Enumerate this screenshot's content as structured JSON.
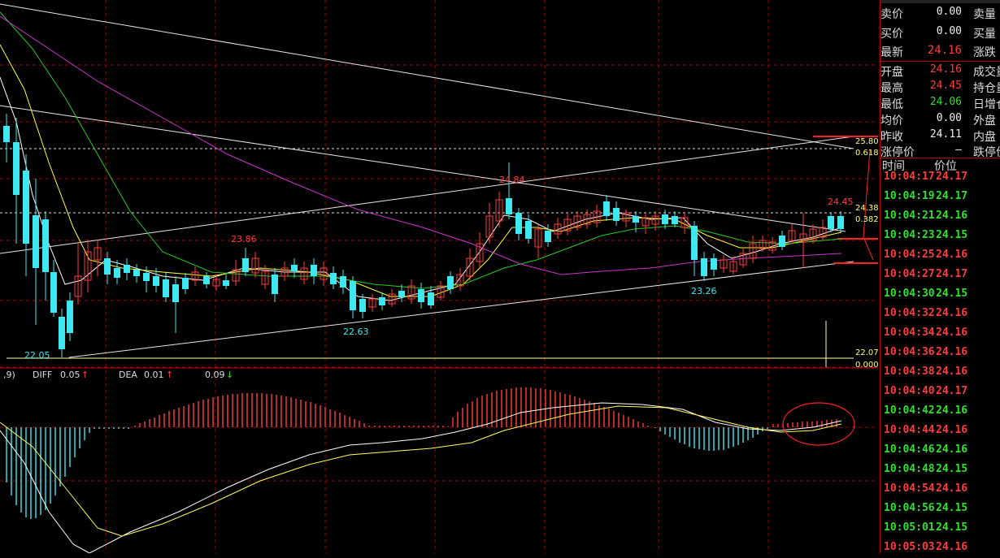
{
  "chart_labels": {
    "high_price": "24.84",
    "mid_peak": "23.86",
    "low_left": "22.05",
    "low_mid": "22.63",
    "low_right": "23.26",
    "recent_high": "24.45",
    "level_upper": "25.80",
    "fib_upper": "0.618",
    "level_mid": "24.38",
    "fib_mid": "0.382",
    "level_lower": "22.07",
    "fib_lower": "0.000"
  },
  "macd": {
    "params": ",9)",
    "diff_label": "DIFF",
    "diff_value": "0.05",
    "diff_arrow": "↑",
    "dea_label": "DEA",
    "dea_value": "0.01",
    "dea_arrow": "↑",
    "macd_value": "0.09",
    "macd_arrow": "↓"
  },
  "quote": {
    "sell_label": "卖价",
    "sell_value": "0.00",
    "sell_vol_label": "卖量",
    "buy_label": "买价",
    "buy_value": "0.00",
    "buy_vol_label": "买量",
    "last_label": "最新",
    "last_value": "24.16",
    "change_label": "涨跌",
    "open_label": "开盘",
    "open_value": "24.16",
    "volume_label": "成交量",
    "high_label": "最高",
    "high_value": "24.45",
    "position_label": "持仓量",
    "low_label": "最低",
    "low_value": "24.06",
    "daily_inc_label": "日增仓",
    "avg_label": "均价",
    "avg_value": "0.00",
    "outer_label": "外盘",
    "prev_label": "昨收",
    "prev_value": "24.11",
    "inner_label": "内盘",
    "limit_up_label": "涨停价",
    "limit_up_value": "—",
    "limit_down_label": "跌停价"
  },
  "ticks_header": {
    "time": "时间",
    "price": "价位"
  },
  "ticks": [
    {
      "time": "10:04:17",
      "price": "24.17",
      "tc": "r",
      "pc": "r"
    },
    {
      "time": "10:04:19",
      "price": "24.17",
      "tc": "g",
      "pc": "g"
    },
    {
      "time": "10:04:21",
      "price": "24.16",
      "tc": "g",
      "pc": "g"
    },
    {
      "time": "10:04:23",
      "price": "24.15",
      "tc": "g",
      "pc": "g"
    },
    {
      "time": "10:04:25",
      "price": "24.16",
      "tc": "r",
      "pc": "r"
    },
    {
      "time": "10:04:27",
      "price": "24.17",
      "tc": "r",
      "pc": "r"
    },
    {
      "time": "10:04:30",
      "price": "24.15",
      "tc": "g",
      "pc": "g"
    },
    {
      "time": "10:04:32",
      "price": "24.16",
      "tc": "r",
      "pc": "r"
    },
    {
      "time": "10:04:34",
      "price": "24.16",
      "tc": "r",
      "pc": "r"
    },
    {
      "time": "10:04:36",
      "price": "24.16",
      "tc": "r",
      "pc": "r"
    },
    {
      "time": "10:04:38",
      "price": "24.16",
      "tc": "r",
      "pc": "r"
    },
    {
      "time": "10:04:40",
      "price": "24.17",
      "tc": "r",
      "pc": "r"
    },
    {
      "time": "10:04:42",
      "price": "24.16",
      "tc": "g",
      "pc": "g"
    },
    {
      "time": "10:04:44",
      "price": "24.16",
      "tc": "r",
      "pc": "r"
    },
    {
      "time": "10:04:46",
      "price": "24.16",
      "tc": "g",
      "pc": "g"
    },
    {
      "time": "10:04:48",
      "price": "24.15",
      "tc": "g",
      "pc": "g"
    },
    {
      "time": "10:04:54",
      "price": "24.16",
      "tc": "r",
      "pc": "r"
    },
    {
      "time": "10:04:56",
      "price": "24.15",
      "tc": "g",
      "pc": "g"
    },
    {
      "time": "10:05:01",
      "price": "24.15",
      "tc": "g",
      "pc": "g"
    },
    {
      "time": "10:05:03",
      "price": "24.16",
      "tc": "r",
      "pc": "r"
    }
  ],
  "colors": {
    "up": "#ff3c3c",
    "down": "#3ee8f0",
    "ma5": "#ffffff",
    "ma10": "#ffff40",
    "ma20": "#22cc22",
    "ma60": "#cc33cc",
    "grid": "#a00000",
    "trend": "#e8e8e8"
  }
}
